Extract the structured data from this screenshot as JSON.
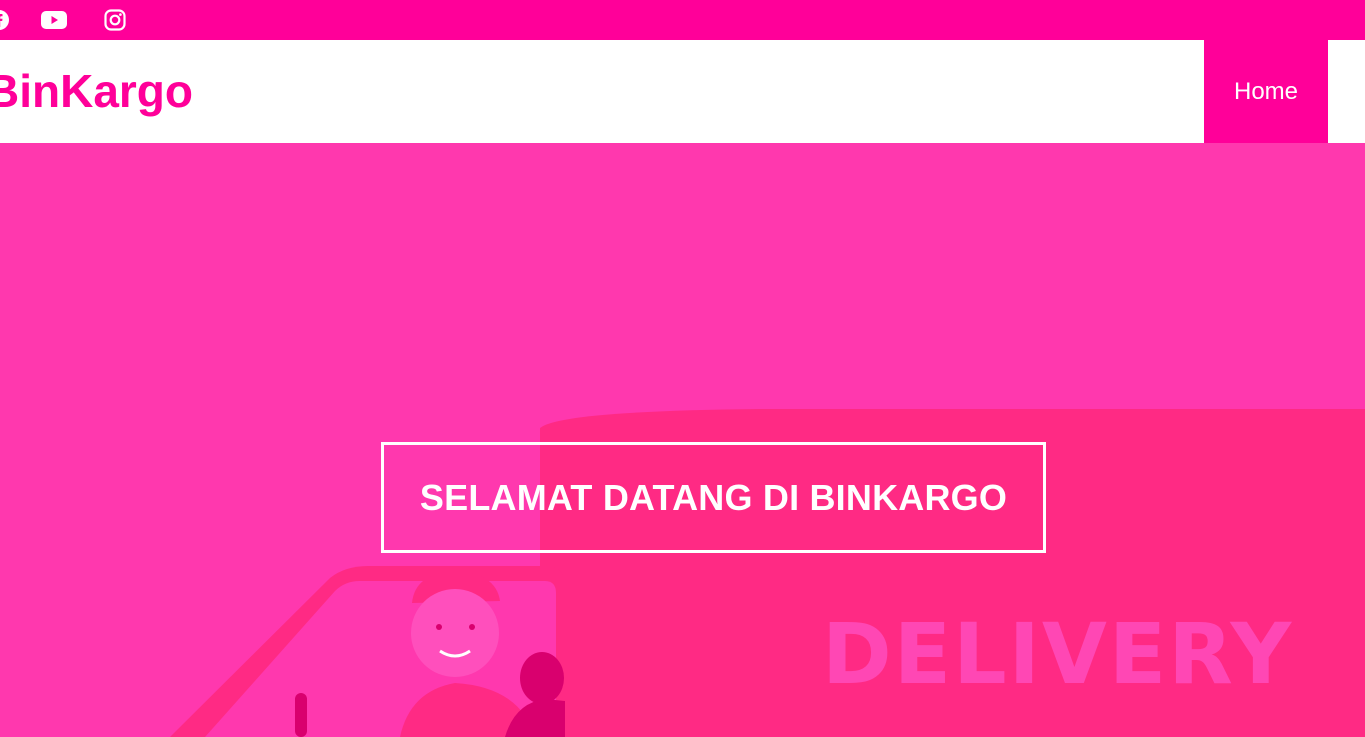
{
  "brand": {
    "name": "BinKargo",
    "color": "#ff0099"
  },
  "social": [
    {
      "icon": "facebook-icon"
    },
    {
      "icon": "youtube-icon"
    },
    {
      "icon": "instagram-icon"
    }
  ],
  "nav": {
    "items": [
      {
        "label": "Home",
        "active": true
      }
    ]
  },
  "hero": {
    "title": "SELAMAT DATANG DI BINKARGO",
    "truck_text": "DELIVERY",
    "overlay_color": "#ff38ae",
    "truck_color": "#ff2a84"
  }
}
